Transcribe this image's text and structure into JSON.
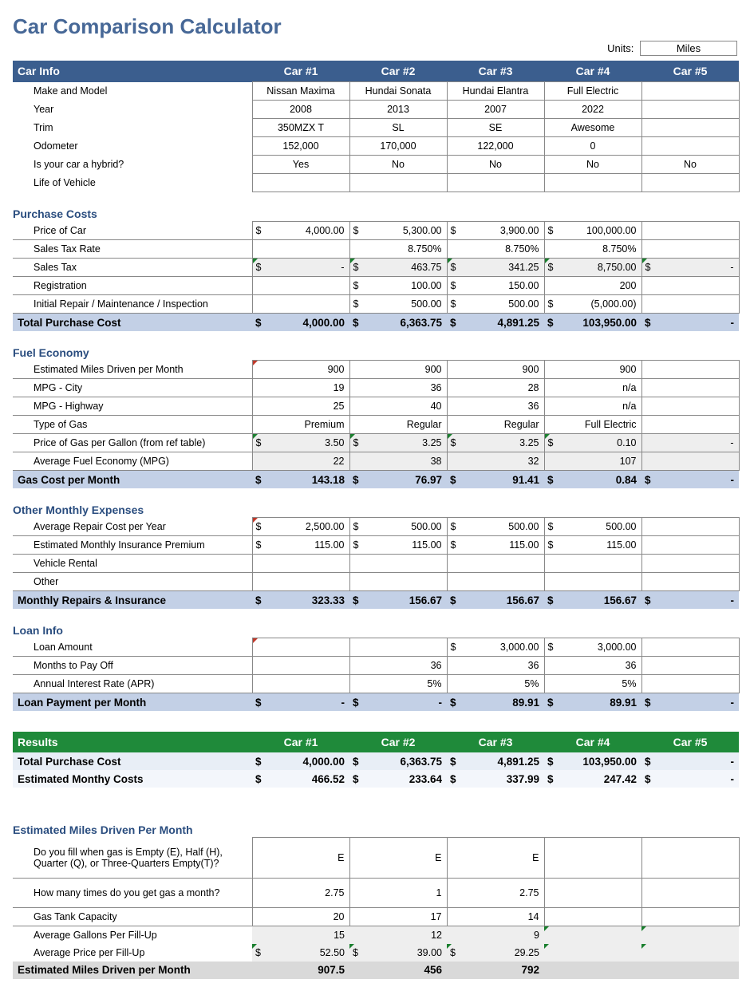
{
  "title": "Car Comparison Calculator",
  "unitsLabel": "Units:",
  "unitsValue": "Miles",
  "cols": [
    "Car #1",
    "Car #2",
    "Car #3",
    "Car #4",
    "Car #5"
  ],
  "carInfo": {
    "header": "Car Info",
    "rows": {
      "make": {
        "label": "Make and Model",
        "v": [
          "Nissan Maxima",
          "Hundai Sonata",
          "Hundai Elantra",
          "Full Electric",
          ""
        ]
      },
      "year": {
        "label": "Year",
        "v": [
          "2008",
          "2013",
          "2007",
          "2022",
          ""
        ]
      },
      "trim": {
        "label": "Trim",
        "v": [
          "350MZX T",
          "SL",
          "SE",
          "Awesome",
          ""
        ]
      },
      "odo": {
        "label": "Odometer",
        "v": [
          "152,000",
          "170,000",
          "122,000",
          "0",
          ""
        ]
      },
      "hybrid": {
        "label": "Is your car a hybrid?",
        "v": [
          "Yes",
          "No",
          "No",
          "No",
          "No"
        ]
      },
      "life": {
        "label": "Life of Vehicle",
        "v": [
          "",
          "",
          "",
          "",
          ""
        ]
      }
    }
  },
  "purchase": {
    "header": "Purchase Costs",
    "rows": {
      "price": {
        "label": "Price of Car",
        "v": [
          "4,000.00",
          "5,300.00",
          "3,900.00",
          "100,000.00",
          ""
        ]
      },
      "taxrate": {
        "label": "Sales Tax Rate",
        "v": [
          "",
          "8.750%",
          "8.750%",
          "8.750%",
          ""
        ]
      },
      "tax": {
        "label": "Sales Tax",
        "v": [
          "-",
          "463.75",
          "341.25",
          "8,750.00",
          "-"
        ]
      },
      "reg": {
        "label": "Registration",
        "v": [
          "",
          "100.00",
          "150.00",
          "200",
          ""
        ]
      },
      "repair": {
        "label": "Initial Repair / Maintenance / Inspection",
        "v": [
          "",
          "500.00",
          "500.00",
          "(5,000.00)",
          ""
        ]
      }
    },
    "total": {
      "label": "Total Purchase Cost",
      "v": [
        "4,000.00",
        "6,363.75",
        "4,891.25",
        "103,950.00",
        "-"
      ]
    }
  },
  "fuel": {
    "header": "Fuel Economy",
    "rows": {
      "miles": {
        "label": "Estimated Miles Driven per Month",
        "v": [
          "900",
          "900",
          "900",
          "900",
          ""
        ]
      },
      "city": {
        "label": "MPG - City",
        "v": [
          "19",
          "36",
          "28",
          "n/a",
          ""
        ]
      },
      "hwy": {
        "label": "MPG - Highway",
        "v": [
          "25",
          "40",
          "36",
          "n/a",
          ""
        ]
      },
      "gastype": {
        "label": "Type of Gas",
        "v": [
          "Premium",
          "Regular",
          "Regular",
          "Full Electric",
          ""
        ]
      },
      "price": {
        "label": "Price of Gas per Gallon (from ref table)",
        "v": [
          "3.50",
          "3.25",
          "3.25",
          "0.10",
          "-"
        ]
      },
      "avgmpg": {
        "label": "Average Fuel Economy (MPG)",
        "v": [
          "22",
          "38",
          "32",
          "107",
          ""
        ]
      }
    },
    "total": {
      "label": "Gas Cost per Month",
      "v": [
        "143.18",
        "76.97",
        "91.41",
        "0.84",
        "-"
      ]
    }
  },
  "other": {
    "header": "Other Monthly Expenses",
    "rows": {
      "repair": {
        "label": "Average Repair Cost per Year",
        "v": [
          "2,500.00",
          "500.00",
          "500.00",
          "500.00",
          ""
        ]
      },
      "ins": {
        "label": "Estimated Monthly Insurance Premium",
        "v": [
          "115.00",
          "115.00",
          "115.00",
          "115.00",
          ""
        ]
      },
      "rent": {
        "label": "Vehicle Rental",
        "v": [
          "",
          "",
          "",
          "",
          ""
        ]
      },
      "oth": {
        "label": "Other",
        "v": [
          "",
          "",
          "",
          "",
          ""
        ]
      }
    },
    "total": {
      "label": "Monthly Repairs & Insurance",
      "v": [
        "323.33",
        "156.67",
        "156.67",
        "156.67",
        "-"
      ]
    }
  },
  "loan": {
    "header": "Loan Info",
    "rows": {
      "amt": {
        "label": "Loan Amount",
        "v": [
          "",
          "",
          "3,000.00",
          "3,000.00",
          ""
        ]
      },
      "mo": {
        "label": "Months to Pay Off",
        "v": [
          "",
          "36",
          "36",
          "36",
          ""
        ]
      },
      "apr": {
        "label": "Annual Interest Rate (APR)",
        "v": [
          "",
          "5%",
          "5%",
          "5%",
          ""
        ]
      }
    },
    "total": {
      "label": "Loan Payment per Month",
      "v": [
        "-",
        "-",
        "89.91",
        "89.91",
        "-"
      ]
    }
  },
  "results": {
    "header": "Results",
    "rows": {
      "tpc": {
        "label": "Total Purchase Cost",
        "v": [
          "4,000.00",
          "6,363.75",
          "4,891.25",
          "103,950.00",
          "-"
        ]
      },
      "emc": {
        "label": "Estimated Monthy Costs",
        "v": [
          "466.52",
          "233.64",
          "337.99",
          "247.42",
          "-"
        ]
      }
    }
  },
  "miles": {
    "header": "Estimated Miles Driven Per Month",
    "rows": {
      "fill": {
        "label": "Do you fill when gas is Empty (E), Half (H), Quarter (Q), or Three-Quarters Empty(T)?",
        "v": [
          "E",
          "E",
          "E",
          "",
          ""
        ]
      },
      "times": {
        "label": "How many times do you get gas a month?",
        "v": [
          "2.75",
          "1",
          "2.75",
          "",
          ""
        ]
      },
      "tank": {
        "label": "Gas Tank Capacity",
        "v": [
          "20",
          "17",
          "14",
          "",
          ""
        ]
      },
      "gal": {
        "label": "Average Gallons Per Fill-Up",
        "v": [
          "15",
          "12",
          "9",
          "",
          ""
        ]
      },
      "price": {
        "label": "Average Price per Fill-Up",
        "v": [
          "52.50",
          "39.00",
          "29.25",
          "",
          ""
        ]
      }
    },
    "total": {
      "label": "Estimated Miles Driven per Month",
      "v": [
        "907.5",
        "456",
        "792",
        "",
        ""
      ]
    }
  }
}
